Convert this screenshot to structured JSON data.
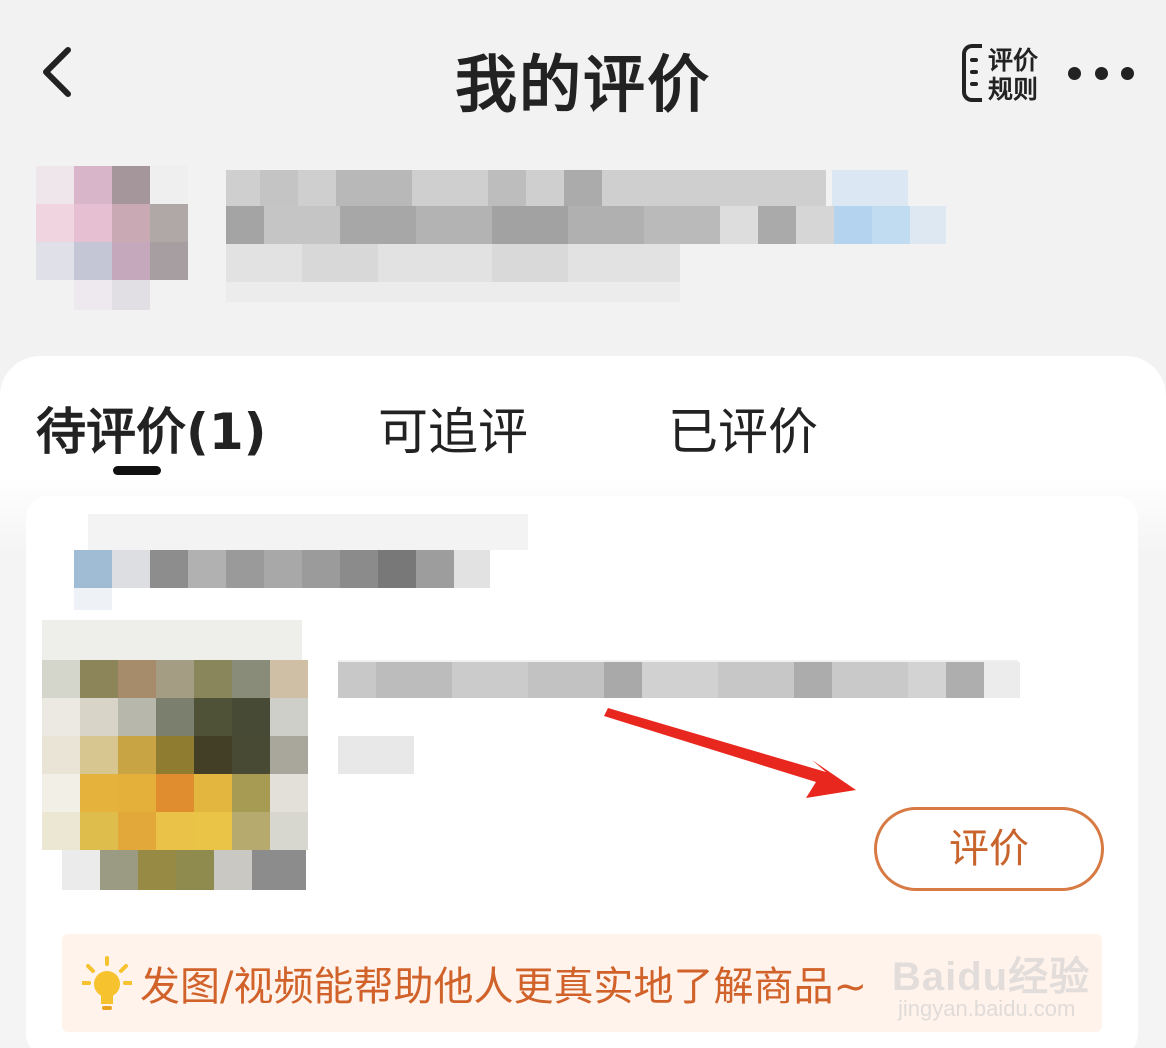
{
  "header": {
    "title": "我的评价",
    "rules_label": "评价规则",
    "back_icon": "chevron-left-icon",
    "more_icon": "more-dots-icon"
  },
  "tabs": [
    {
      "label": "待评价(1)",
      "active": true
    },
    {
      "label": "可追评",
      "active": false
    },
    {
      "label": "已评价",
      "active": false
    }
  ],
  "order": {
    "action_label": "评价",
    "accent_color": "#d77a43"
  },
  "tip": {
    "text": "发图/视频能帮助他人更真实地了解商品~",
    "icon": "lightbulb-icon"
  },
  "watermark": {
    "logo": "Baidu经验",
    "url": "jingyan.baidu.com"
  }
}
